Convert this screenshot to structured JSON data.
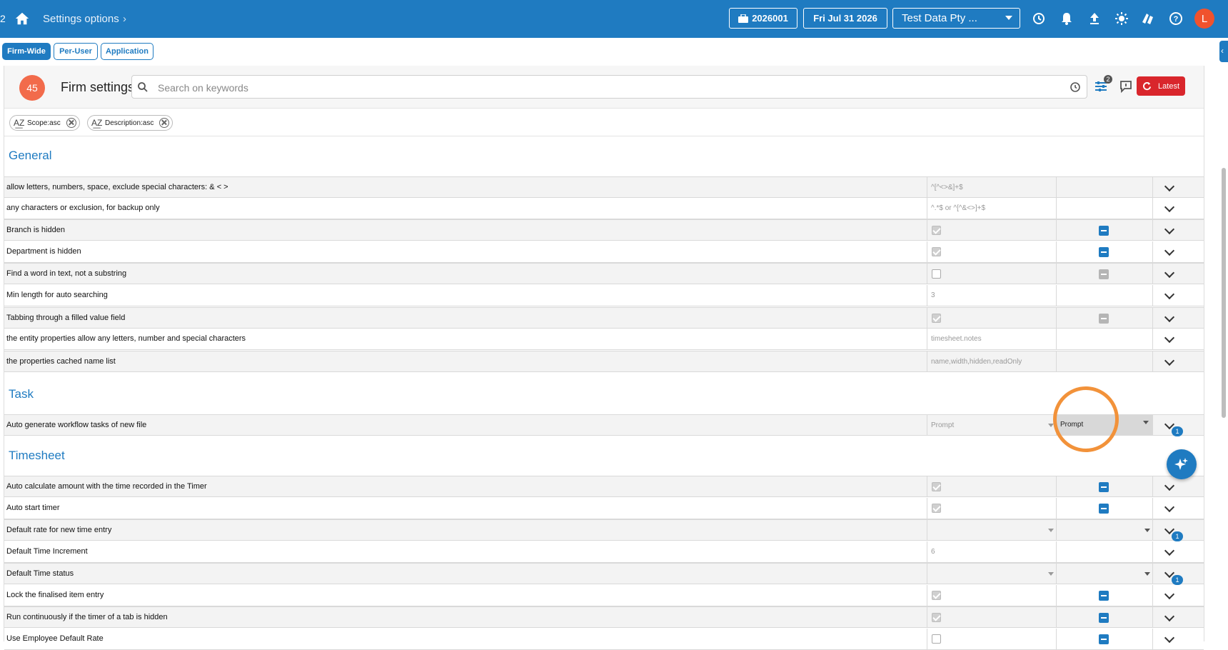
{
  "topbar": {
    "number": "2",
    "breadcrumb": "Settings options",
    "matter": "2026001",
    "date": "Fri Jul 31 2026",
    "company": "Test Data Pty ...",
    "avatar": "L",
    "icons": [
      "history-icon",
      "bell-icon",
      "upload-icon",
      "theme-icon",
      "book-icon",
      "help-icon"
    ]
  },
  "scope_tabs": [
    {
      "label": "Firm-Wide",
      "active": true
    },
    {
      "label": "Per-User",
      "active": false
    },
    {
      "label": "Application",
      "active": false
    }
  ],
  "header": {
    "count": "45",
    "title": "Firm settings",
    "search_placeholder": "Search on keywords",
    "filter_badge": "2",
    "latest_label": "Latest"
  },
  "sorts": [
    {
      "label": "Scope:asc"
    },
    {
      "label": "Description:asc"
    }
  ],
  "groups": {
    "general": {
      "title": "General",
      "rows": [
        {
          "desc": "allow letters, numbers, space, exclude special characters: & < >",
          "value": "^[^<>&]+$"
        },
        {
          "desc": "any characters or exclusion,  for backup only",
          "value": "^.*$   or   ^[^&<>]+$"
        },
        {
          "desc": "Branch is hidden",
          "checked": true,
          "user": "blue"
        },
        {
          "desc": "Department is hidden",
          "checked": true,
          "user": "blue"
        },
        {
          "desc": "Find a word in text, not a substring",
          "checked": false,
          "user": "grey"
        },
        {
          "desc": "Min length for auto searching",
          "value": "3"
        },
        {
          "desc": "Tabbing through a filled value field",
          "checked": true,
          "user": "grey"
        },
        {
          "desc": "the entity properties allow any letters, number and special characters",
          "value": "timesheet.notes"
        },
        {
          "desc": "the properties cached name list",
          "value": "name,width,hidden,readOnly"
        }
      ]
    },
    "task": {
      "title": "Task",
      "rows": [
        {
          "desc": "Auto generate workflow tasks of new file",
          "value": "Prompt",
          "user_value": "Prompt",
          "badge": "1"
        }
      ]
    },
    "timesheet": {
      "title": "Timesheet",
      "rows": [
        {
          "desc": "Auto calculate amount with the time recorded in the Timer",
          "checked": true,
          "user": "blue"
        },
        {
          "desc": "Auto start timer",
          "checked": true,
          "user": "blue"
        },
        {
          "desc": "Default rate for new time entry",
          "badge": "1"
        },
        {
          "desc": "Default Time Increment",
          "value": "6"
        },
        {
          "desc": "Default Time status",
          "badge": "1"
        },
        {
          "desc": "Lock the finalised item entry",
          "checked": true,
          "user": "blue"
        },
        {
          "desc": "Run continuously if the timer of a tab is hidden",
          "checked": true,
          "user": "blue"
        },
        {
          "desc": "Use Employee Default Rate",
          "checked": false,
          "user": "blue"
        }
      ]
    }
  },
  "colors": {
    "primary": "#1f7bc1",
    "danger": "#d9262c",
    "highlight": "#f2923a",
    "count_badge": "#f26b4b"
  }
}
